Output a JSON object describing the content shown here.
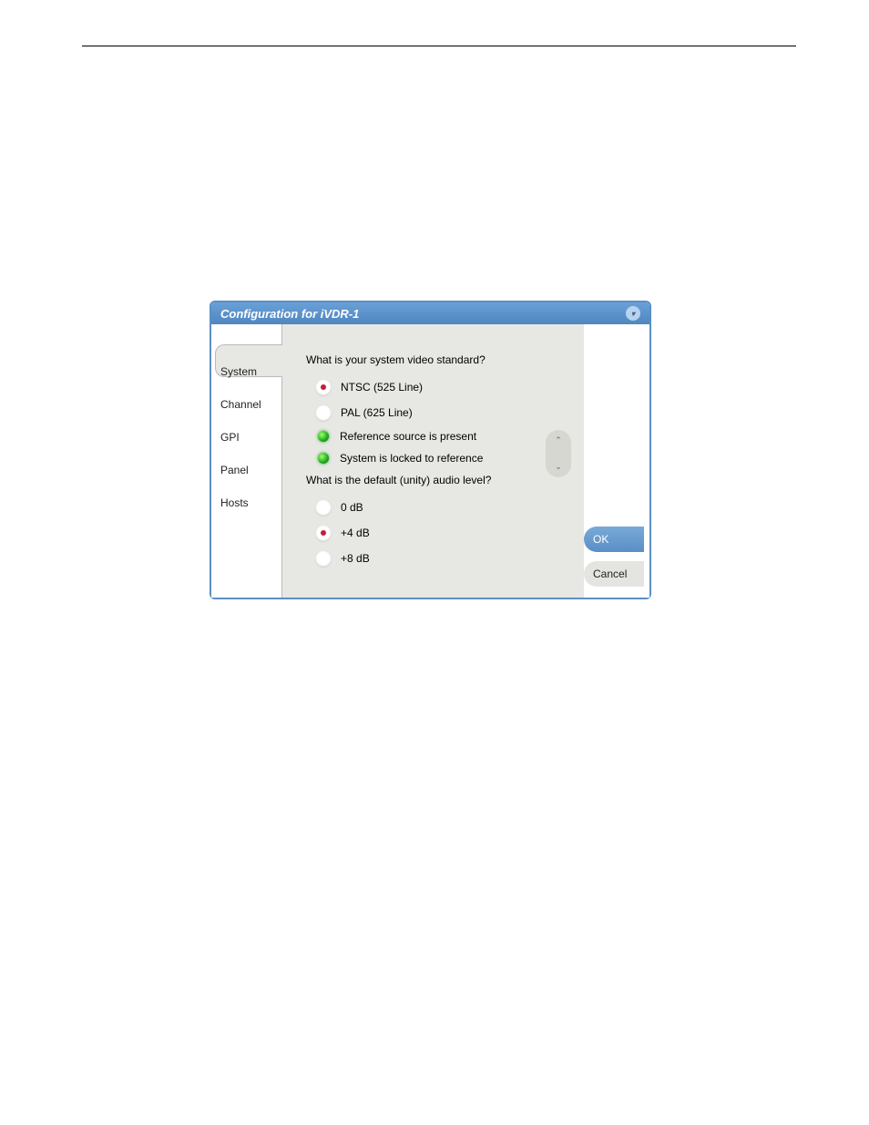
{
  "dialog": {
    "title": "Configuration for iVDR-1",
    "tabs": [
      {
        "label": "System"
      },
      {
        "label": "Channel"
      },
      {
        "label": "GPI"
      },
      {
        "label": "Panel"
      },
      {
        "label": "Hosts"
      }
    ],
    "content": {
      "video_standard_question": "What is your system video standard?",
      "video_options": [
        {
          "label": "NTSC (525 Line)",
          "selected": true
        },
        {
          "label": "PAL (625 Line)",
          "selected": false
        }
      ],
      "status": [
        {
          "label": "Reference source is present"
        },
        {
          "label": "System is locked to reference"
        }
      ],
      "audio_level_question": "What is the default (unity) audio level?",
      "audio_options": [
        {
          "label": "0 dB",
          "selected": false
        },
        {
          "label": "+4 dB",
          "selected": true
        },
        {
          "label": "+8 dB",
          "selected": false
        }
      ]
    },
    "buttons": {
      "ok": "OK",
      "cancel": "Cancel"
    }
  }
}
